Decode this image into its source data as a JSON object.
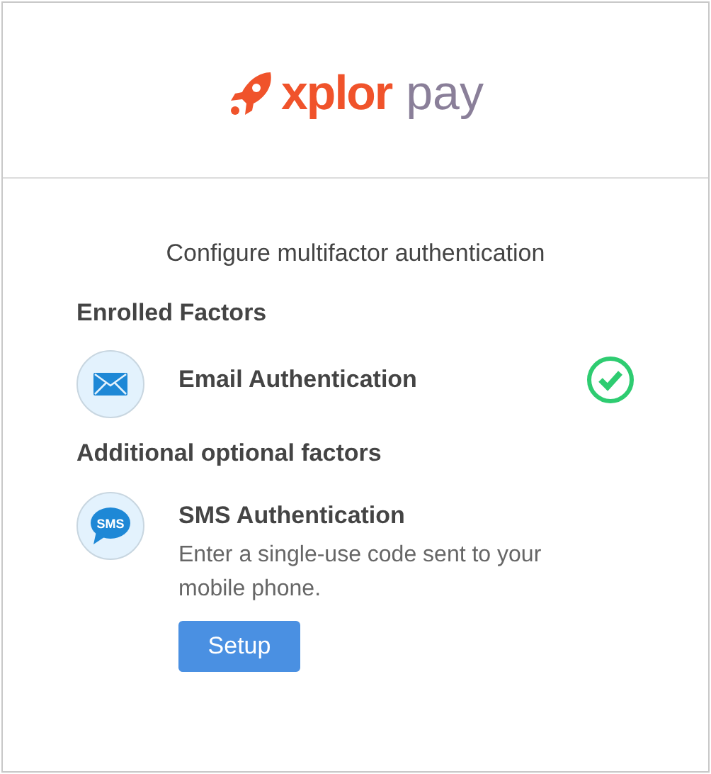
{
  "logo": {
    "brand": "xplor",
    "product": "pay"
  },
  "title": "Configure multifactor authentication",
  "sections": [
    {
      "heading": "Enrolled Factors",
      "factors": [
        {
          "kind": "email",
          "name": "Email Authentication",
          "enrolled": true
        }
      ]
    },
    {
      "heading": "Additional optional factors",
      "factors": [
        {
          "kind": "sms",
          "icon_text": "SMS",
          "name": "SMS Authentication",
          "description": "Enter a single-use code sent to your mobile phone.",
          "button": "Setup"
        }
      ]
    }
  ]
}
